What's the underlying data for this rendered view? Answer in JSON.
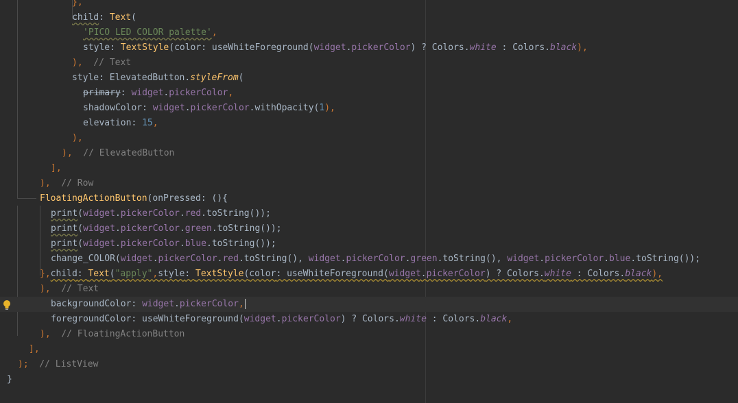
{
  "editor": {
    "lines": [
      {
        "indent": 105,
        "tokens": [
          {
            "t": "},",
            "c": "tok-keyword"
          }
        ]
      },
      {
        "indent": 105,
        "tokens": [
          {
            "t": "child",
            "c": "tok-default squig-gray"
          },
          {
            "t": ": ",
            "c": "tok-default"
          },
          {
            "t": "Text",
            "c": "tok-class"
          },
          {
            "t": "(",
            "c": "tok-default"
          }
        ]
      },
      {
        "indent": 121,
        "tokens": [
          {
            "t": "'PICO LED COLOR palette'",
            "c": "tok-string squig-gray"
          },
          {
            "t": ",",
            "c": "tok-keyword"
          }
        ]
      },
      {
        "indent": 121,
        "tokens": [
          {
            "t": "style",
            "c": "tok-default"
          },
          {
            "t": ": ",
            "c": "tok-default"
          },
          {
            "t": "TextStyle",
            "c": "tok-class"
          },
          {
            "t": "(",
            "c": "tok-default"
          },
          {
            "t": "color",
            "c": "tok-default"
          },
          {
            "t": ": useWhiteForeground(",
            "c": "tok-default"
          },
          {
            "t": "widget",
            "c": "tok-prop"
          },
          {
            "t": ".",
            "c": "tok-default"
          },
          {
            "t": "pickerColor",
            "c": "tok-prop"
          },
          {
            "t": ") ? Colors.",
            "c": "tok-default"
          },
          {
            "t": "white",
            "c": "tok-italic"
          },
          {
            "t": " : Colors.",
            "c": "tok-default"
          },
          {
            "t": "black",
            "c": "tok-italic"
          },
          {
            "t": "),",
            "c": "tok-keyword"
          }
        ]
      },
      {
        "indent": 105,
        "tokens": [
          {
            "t": "),",
            "c": "tok-keyword"
          },
          {
            "t": "  // Text",
            "c": "tok-comment"
          }
        ]
      },
      {
        "indent": 105,
        "tokens": [
          {
            "t": "style",
            "c": "tok-default"
          },
          {
            "t": ": ElevatedButton.",
            "c": "tok-default"
          },
          {
            "t": "styleFrom",
            "c": "tok-method"
          },
          {
            "t": "(",
            "c": "tok-default"
          }
        ]
      },
      {
        "indent": 121,
        "tokens": [
          {
            "t": "primary",
            "c": "tok-strike"
          },
          {
            "t": ": ",
            "c": "tok-default"
          },
          {
            "t": "widget",
            "c": "tok-prop"
          },
          {
            "t": ".",
            "c": "tok-default"
          },
          {
            "t": "pickerColor",
            "c": "tok-prop"
          },
          {
            "t": ",",
            "c": "tok-keyword"
          }
        ]
      },
      {
        "indent": 121,
        "tokens": [
          {
            "t": "shadowColor",
            "c": "tok-default"
          },
          {
            "t": ": ",
            "c": "tok-default"
          },
          {
            "t": "widget",
            "c": "tok-prop"
          },
          {
            "t": ".",
            "c": "tok-default"
          },
          {
            "t": "pickerColor",
            "c": "tok-prop"
          },
          {
            "t": ".withOpacity(",
            "c": "tok-default"
          },
          {
            "t": "1",
            "c": "tok-number"
          },
          {
            "t": "),",
            "c": "tok-keyword"
          }
        ]
      },
      {
        "indent": 121,
        "tokens": [
          {
            "t": "elevation",
            "c": "tok-default"
          },
          {
            "t": ": ",
            "c": "tok-default"
          },
          {
            "t": "15",
            "c": "tok-number"
          },
          {
            "t": ",",
            "c": "tok-keyword"
          }
        ]
      },
      {
        "indent": 105,
        "tokens": [
          {
            "t": "),",
            "c": "tok-keyword"
          }
        ]
      },
      {
        "indent": 90,
        "tokens": [
          {
            "t": "),",
            "c": "tok-keyword"
          },
          {
            "t": "  // ElevatedButton",
            "c": "tok-comment"
          }
        ]
      },
      {
        "indent": 74,
        "tokens": [
          {
            "t": "],",
            "c": "tok-keyword"
          }
        ]
      },
      {
        "indent": 58,
        "tokens": [
          {
            "t": "),",
            "c": "tok-keyword"
          },
          {
            "t": "  // Row",
            "c": "tok-comment"
          }
        ]
      },
      {
        "indent": 58,
        "tokens": [
          {
            "t": "FloatingActionButton",
            "c": "tok-class"
          },
          {
            "t": "(",
            "c": "tok-default"
          },
          {
            "t": "onPressed",
            "c": "tok-default"
          },
          {
            "t": ": (){",
            "c": "tok-default"
          }
        ]
      },
      {
        "indent": 74,
        "tokens": [
          {
            "t": "print",
            "c": "tok-default squig-gray"
          },
          {
            "t": "(",
            "c": "tok-default"
          },
          {
            "t": "widget",
            "c": "tok-prop"
          },
          {
            "t": ".",
            "c": "tok-default"
          },
          {
            "t": "pickerColor",
            "c": "tok-prop"
          },
          {
            "t": ".",
            "c": "tok-default"
          },
          {
            "t": "red",
            "c": "tok-prop"
          },
          {
            "t": ".toString());",
            "c": "tok-default"
          }
        ]
      },
      {
        "indent": 74,
        "tokens": [
          {
            "t": "print",
            "c": "tok-default squig-gray"
          },
          {
            "t": "(",
            "c": "tok-default"
          },
          {
            "t": "widget",
            "c": "tok-prop"
          },
          {
            "t": ".",
            "c": "tok-default"
          },
          {
            "t": "pickerColor",
            "c": "tok-prop"
          },
          {
            "t": ".",
            "c": "tok-default"
          },
          {
            "t": "green",
            "c": "tok-prop"
          },
          {
            "t": ".toString());",
            "c": "tok-default"
          }
        ]
      },
      {
        "indent": 74,
        "tokens": [
          {
            "t": "print",
            "c": "tok-default squig-gray"
          },
          {
            "t": "(",
            "c": "tok-default"
          },
          {
            "t": "widget",
            "c": "tok-prop"
          },
          {
            "t": ".",
            "c": "tok-default"
          },
          {
            "t": "pickerColor",
            "c": "tok-prop"
          },
          {
            "t": ".",
            "c": "tok-default"
          },
          {
            "t": "blue",
            "c": "tok-prop"
          },
          {
            "t": ".toString());",
            "c": "tok-default"
          }
        ]
      },
      {
        "indent": 74,
        "tokens": [
          {
            "t": "change_COLOR(",
            "c": "tok-default"
          },
          {
            "t": "widget",
            "c": "tok-prop"
          },
          {
            "t": ".",
            "c": "tok-default"
          },
          {
            "t": "pickerColor",
            "c": "tok-prop"
          },
          {
            "t": ".",
            "c": "tok-default"
          },
          {
            "t": "red",
            "c": "tok-prop"
          },
          {
            "t": ".toString(), ",
            "c": "tok-default"
          },
          {
            "t": "widget",
            "c": "tok-prop"
          },
          {
            "t": ".",
            "c": "tok-default"
          },
          {
            "t": "pickerColor",
            "c": "tok-prop"
          },
          {
            "t": ".",
            "c": "tok-default"
          },
          {
            "t": "green",
            "c": "tok-prop"
          },
          {
            "t": ".toString(), ",
            "c": "tok-default"
          },
          {
            "t": "widget",
            "c": "tok-prop"
          },
          {
            "t": ".",
            "c": "tok-default"
          },
          {
            "t": "pickerColor",
            "c": "tok-prop"
          },
          {
            "t": ".",
            "c": "tok-default"
          },
          {
            "t": "blue",
            "c": "tok-prop"
          },
          {
            "t": ".toString());",
            "c": "tok-default"
          }
        ]
      },
      {
        "indent": 58,
        "tokens": [
          {
            "t": "},",
            "c": "tok-keyword"
          },
          {
            "t": "child",
            "c": "tok-default squig"
          },
          {
            "t": ": ",
            "c": "tok-default squig"
          },
          {
            "t": "Text",
            "c": "tok-class squig"
          },
          {
            "t": "(",
            "c": "tok-default squig"
          },
          {
            "t": "\"apply\"",
            "c": "tok-string squig"
          },
          {
            "t": ",",
            "c": "tok-keyword squig"
          },
          {
            "t": "style",
            "c": "tok-default squig"
          },
          {
            "t": ": ",
            "c": "tok-default squig"
          },
          {
            "t": "TextStyle",
            "c": "tok-class squig"
          },
          {
            "t": "(",
            "c": "tok-default squig"
          },
          {
            "t": "color",
            "c": "tok-default squig"
          },
          {
            "t": ": useWhiteForeground(",
            "c": "tok-default squig"
          },
          {
            "t": "widget",
            "c": "tok-prop squig"
          },
          {
            "t": ".",
            "c": "tok-default squig"
          },
          {
            "t": "pickerColor",
            "c": "tok-prop squig"
          },
          {
            "t": ") ? Colors.",
            "c": "tok-default squig"
          },
          {
            "t": "white",
            "c": "tok-italic squig"
          },
          {
            "t": " : Colors.",
            "c": "tok-default squig"
          },
          {
            "t": "black",
            "c": "tok-italic squig"
          },
          {
            "t": "),",
            "c": "tok-keyword squig"
          }
        ]
      },
      {
        "indent": 58,
        "tokens": [
          {
            "t": "),",
            "c": "tok-keyword"
          },
          {
            "t": "  // Text",
            "c": "tok-comment"
          }
        ]
      },
      {
        "indent": 74,
        "tokens": [
          {
            "t": "backgroundColor",
            "c": "tok-default"
          },
          {
            "t": ": ",
            "c": "tok-default"
          },
          {
            "t": "widget",
            "c": "tok-prop"
          },
          {
            "t": ".",
            "c": "tok-default"
          },
          {
            "t": "pickerColor",
            "c": "tok-prop"
          },
          {
            "t": ",",
            "c": "tok-keyword"
          }
        ]
      },
      {
        "indent": 74,
        "tokens": [
          {
            "t": "foregroundColor",
            "c": "tok-default"
          },
          {
            "t": ": useWhiteForeground(",
            "c": "tok-default"
          },
          {
            "t": "widget",
            "c": "tok-prop"
          },
          {
            "t": ".",
            "c": "tok-default"
          },
          {
            "t": "pickerColor",
            "c": "tok-prop"
          },
          {
            "t": ") ? Colors.",
            "c": "tok-default"
          },
          {
            "t": "white",
            "c": "tok-italic"
          },
          {
            "t": " : Colors.",
            "c": "tok-default"
          },
          {
            "t": "black",
            "c": "tok-italic"
          },
          {
            "t": ",",
            "c": "tok-keyword"
          }
        ]
      },
      {
        "indent": 58,
        "tokens": [
          {
            "t": "),",
            "c": "tok-keyword"
          },
          {
            "t": "  // FloatingActionButton",
            "c": "tok-comment"
          }
        ]
      },
      {
        "indent": 42,
        "tokens": [
          {
            "t": "],",
            "c": "tok-keyword"
          }
        ]
      },
      {
        "indent": 26,
        "tokens": [
          {
            "t": ");",
            "c": "tok-keyword"
          },
          {
            "t": "  // ListView",
            "c": "tok-comment"
          }
        ]
      },
      {
        "indent": 10,
        "tokens": [
          {
            "t": "}",
            "c": "tok-default"
          }
        ]
      }
    ],
    "current_line": 20,
    "colors": {
      "background": "#2b2b2b",
      "current_line": "#323232",
      "keyword": "#cc7832",
      "class": "#ffc66d",
      "property": "#9876aa",
      "string": "#6a8759",
      "number": "#6897bb",
      "comment": "#808080",
      "default": "#a9b7c6"
    },
    "gutter_icon": "lightbulb-icon"
  }
}
